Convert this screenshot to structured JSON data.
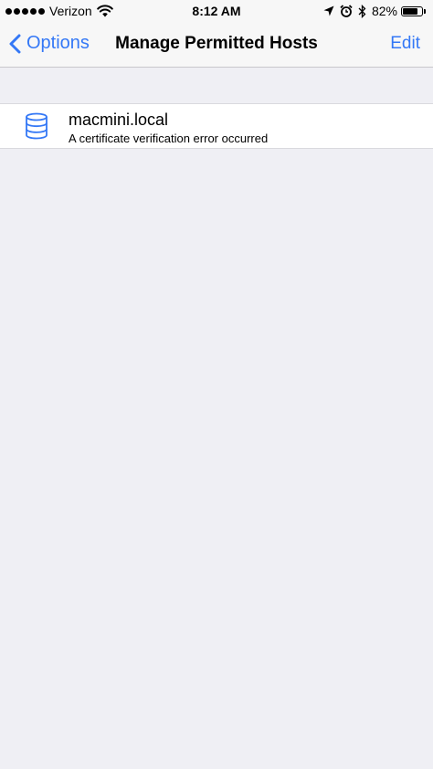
{
  "status_bar": {
    "carrier": "Verizon",
    "time": "8:12 AM",
    "battery_percent": "82%",
    "battery_level": 0.82,
    "icons": [
      "signal-dots-icon",
      "wifi-icon",
      "location-arrow-icon",
      "alarm-clock-icon",
      "bluetooth-icon",
      "battery-icon"
    ]
  },
  "nav_bar": {
    "back_label": "Options",
    "title": "Manage Permitted Hosts",
    "edit_label": "Edit"
  },
  "hosts": [
    {
      "name": "macmini.local",
      "status": "A certificate verification error occurred",
      "icon": "database-icon"
    }
  ],
  "colors": {
    "accent": "#3478f6",
    "background": "#efeff4",
    "nav_background": "#f7f7f7"
  }
}
